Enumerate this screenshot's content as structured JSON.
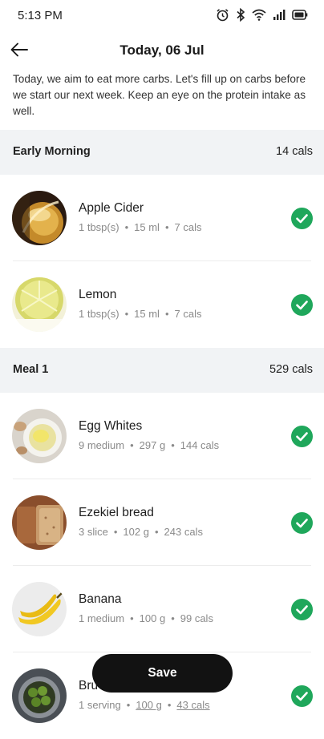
{
  "status_bar": {
    "time": "5:13 PM",
    "icons": [
      "alarm-icon",
      "bluetooth-icon",
      "wifi-icon",
      "signal-icon",
      "battery-icon"
    ]
  },
  "header": {
    "back_icon": "arrow-left-icon",
    "title": "Today, 06 Jul"
  },
  "intro": "Today, we aim to eat more carbs. Let's fill up on carbs before we start our next week. Keep an eye on the protein intake as well.",
  "sections": [
    {
      "name": "Early Morning",
      "cals": "14 cals",
      "items": [
        {
          "name": "Apple Cider",
          "qty": "1 tbsp(s)",
          "weight": "15 ml",
          "cals": "7 cals",
          "checked": true
        },
        {
          "name": "Lemon",
          "qty": "1 tbsp(s)",
          "weight": "15 ml",
          "cals": "7 cals",
          "checked": true
        }
      ]
    },
    {
      "name": "Meal 1",
      "cals": "529 cals",
      "items": [
        {
          "name": "Egg Whites",
          "qty": "9 medium",
          "weight": "297 g",
          "cals": "144 cals",
          "checked": true
        },
        {
          "name": "Ezekiel bread",
          "qty": "3 slice",
          "weight": "102 g",
          "cals": "243 cals",
          "checked": true
        },
        {
          "name": "Banana",
          "qty": "1 medium",
          "weight": "100 g",
          "cals": "99 cals",
          "checked": true
        },
        {
          "name": "Bru",
          "qty": "1 serving",
          "weight": "100 g",
          "cals": "43 cals",
          "checked": true
        }
      ]
    }
  ],
  "colors": {
    "check_green": "#1fa75b",
    "section_bg": "#f1f3f5",
    "save_bg": "#121212"
  },
  "save_label": "Save"
}
